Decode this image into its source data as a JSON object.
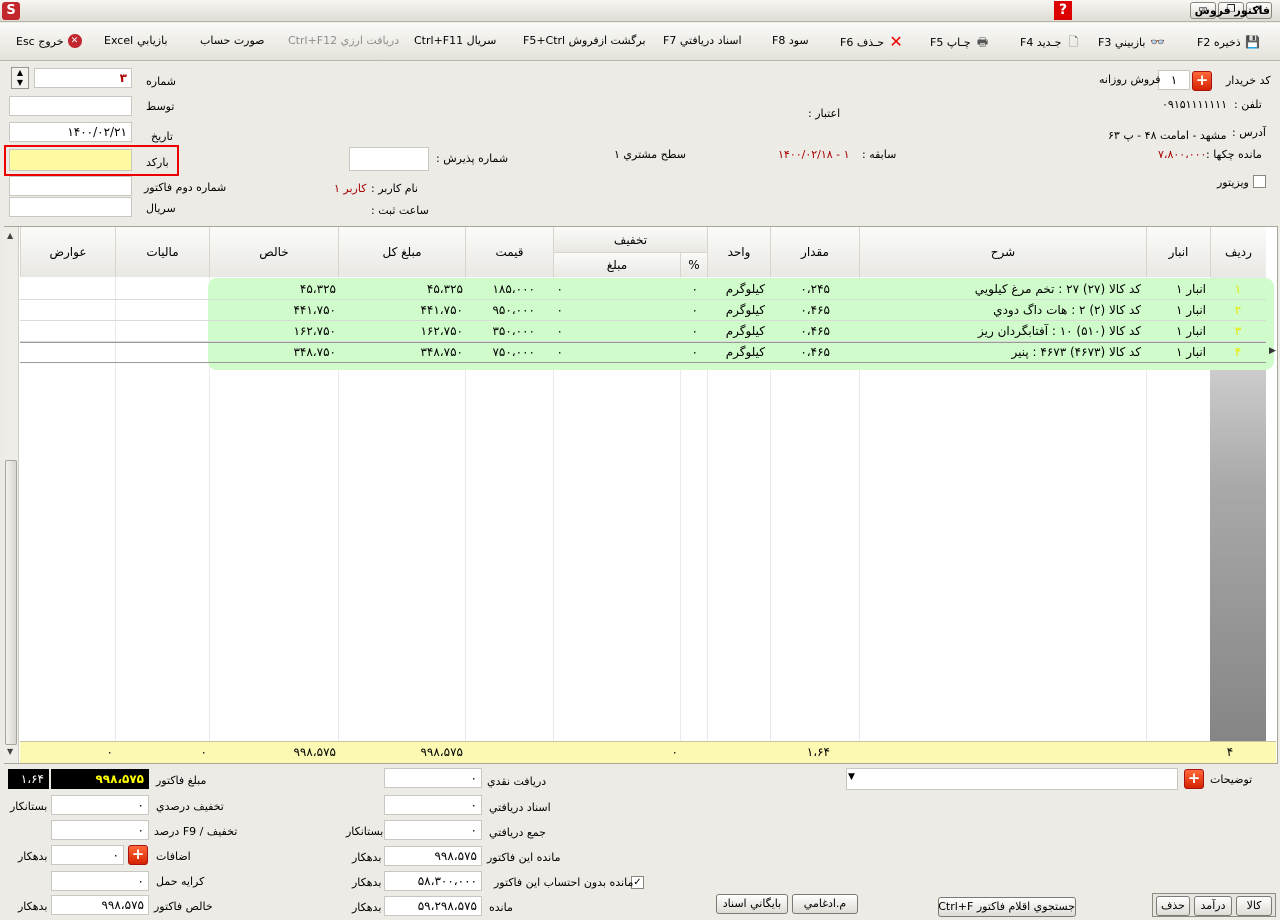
{
  "window": {
    "title": "فاکتور فروش",
    "help_label": "?"
  },
  "toolbar": {
    "save": "ذخيره F2",
    "review": "بازبيني F3",
    "new": "جـديد F4",
    "print": "چـاپ F5",
    "delete": "حـذف F6",
    "profit": "سود F8",
    "received_docs": "اسناد دريافتي F7",
    "return_sale": "برگشت ازفروش F5+Ctrl",
    "serial": "سريال Ctrl+F11",
    "fx_receive": "دريافت ارزي Ctrl+F12",
    "account_statement": "صورت حساب",
    "marketer": "بازيابي",
    "excel": "Excel",
    "exit": "خروج Esc"
  },
  "header": {
    "buyer_code_label": "كد خريدار",
    "buyer_code_value": "۱",
    "buyer_name": "فروش روزانه",
    "phone_label": "تلفن :",
    "phone_value": "۰۹۱۵۱۱۱۱۱۱۱",
    "credit_label": "اعتبار :",
    "address_label": "آدرس :",
    "address_value": "مشهد - امامت ۴۸ - پ ۶۳",
    "checks_balance_label": "مانده چكها :",
    "checks_balance_value": "۷،۸۰۰،۰۰۰",
    "history_label": "سابقه :",
    "history_value": "۱ - ۱۴۰۰/۰۲/۱۸",
    "customer_level": "سطح مشتري ۱",
    "acceptance_no_label": "شماره پذيرش :",
    "visitor_label": "ويزيتور",
    "number_label": "شماره",
    "number_value": "۳",
    "by_label": "توسط",
    "date_label": "تاريخ",
    "date_value": "۱۴۰۰/۰۲/۲۱",
    "barcode_label": "باركد",
    "second_invoice_label": "شماره دوم فاكتور",
    "serial_label": "سريال",
    "username_label": "نام كاربر :",
    "username_value": "كاربر ۱",
    "reg_time_label": "ساعت ثبت :"
  },
  "grid": {
    "columns": {
      "row": "رديف",
      "warehouse": "انبار",
      "desc": "شرح",
      "qty": "مقدار",
      "unit": "واحد",
      "discount": "تخفيف",
      "disc_pct": "%",
      "disc_amount": "مبلغ",
      "price": "قيمت",
      "total": "مبلغ كل",
      "net": "خالص",
      "tax": "ماليات",
      "duties": "عوارض"
    },
    "rows": [
      {
        "num": "۱",
        "warehouse": "انبار ۱",
        "desc": "كد كالا (۲۷) ۲۷ : تخم مرغ كيلويي",
        "qty": "۰،۲۴۵",
        "unit": "كيلوگرم",
        "pct": "۰",
        "disc": "۰",
        "price": "۱۸۵،۰۰۰",
        "total": "۴۵،۳۲۵",
        "net": "۴۵،۳۲۵"
      },
      {
        "num": "۲",
        "warehouse": "انبار ۱",
        "desc": "كد كالا (۲) ۲ : هات داگ دودي",
        "qty": "۰،۴۶۵",
        "unit": "كيلوگرم",
        "pct": "۰",
        "disc": "۰",
        "price": "۹۵۰،۰۰۰",
        "total": "۴۴۱،۷۵۰",
        "net": "۴۴۱،۷۵۰"
      },
      {
        "num": "۳",
        "warehouse": "انبار ۱",
        "desc": "كد كالا (۵۱۰) ۱۰ : آفتابگردان ريز",
        "qty": "۰،۴۶۵",
        "unit": "كيلوگرم",
        "pct": "۰",
        "disc": "۰",
        "price": "۳۵۰،۰۰۰",
        "total": "۱۶۲،۷۵۰",
        "net": "۱۶۲،۷۵۰"
      },
      {
        "num": "۴",
        "warehouse": "انبار ۱",
        "desc": "كد كالا (۴۶۷۳) ۴۶۷۳ : پنير",
        "qty": "۰،۴۶۵",
        "unit": "كيلوگرم",
        "pct": "۰",
        "disc": "۰",
        "price": "۷۵۰،۰۰۰",
        "total": "۳۴۸،۷۵۰",
        "net": "۳۴۸،۷۵۰"
      }
    ],
    "footer": {
      "count": "۴",
      "qty": "۱،۶۴",
      "disc": "۰",
      "total": "۹۹۸،۵۷۵",
      "net": "۹۹۸،۵۷۵",
      "tax": "۰",
      "duties": "۰"
    }
  },
  "bottom": {
    "notes_label": "توضيحات",
    "cash_received_label": "دريافت نقدي",
    "cash_received_value": "۰",
    "docs_received_label": "اسناد دريافتي",
    "docs_received_value": "۰",
    "total_received_label": "جمع دريافتي",
    "total_received_value": "۰",
    "total_received_side": "بستانكار",
    "invoice_balance_label": "مانده اين فاكتور",
    "invoice_balance_value": "۹۹۸،۵۷۵",
    "invoice_balance_side": "بدهكار",
    "balance_wo_label": "مانده بدون احتساب اين فاكتور",
    "balance_wo_value": "۵۸،۳۰۰،۰۰۰",
    "balance_wo_side": "بدهكار",
    "balance_label": "مانده",
    "balance_value": "۵۹،۲۹۸،۵۷۵",
    "balance_side": "بدهكار",
    "invoice_amount_label": "مبلغ فاكتور",
    "invoice_amount_value": "۹۹۸،۵۷۵",
    "invoice_qty_value": "۱،۶۴",
    "pct_discount_label": "تخفيف درصدي",
    "pct_discount_value": "۰",
    "pct_discount_side": "بستانكار",
    "f9_discount_label": "تخفيف / F9 درصد",
    "f9_discount_value": "۰",
    "additions_label": "اضافات",
    "additions_value": "۰",
    "additions_side": "بدهكار",
    "freight_label": "كرايه حمل",
    "freight_value": "۰",
    "net_invoice_label": "خالص فاكتور",
    "net_invoice_value": "۹۹۸،۵۷۵",
    "net_invoice_side": "بدهكار",
    "btn_archive": "بايگاني اسناد",
    "btn_merged": "م.ادغامي",
    "btn_search": "جستجوي اقلام فاكتور Ctrl+F",
    "btn_goods": "كالا",
    "btn_income": "درآمد",
    "btn_delete": "حذف"
  },
  "colors": {
    "accent_red": "#d00000",
    "row_green": "#cffcca",
    "total_yellow": "#fbf9b2"
  }
}
